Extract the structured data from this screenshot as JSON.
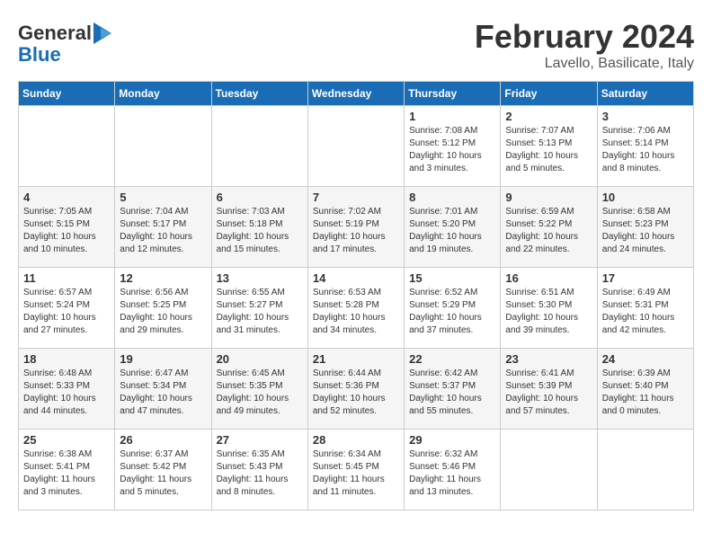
{
  "logo": {
    "line1": "General",
    "line2": "Blue"
  },
  "title": "February 2024",
  "subtitle": "Lavello, Basilicate, Italy",
  "days_of_week": [
    "Sunday",
    "Monday",
    "Tuesday",
    "Wednesday",
    "Thursday",
    "Friday",
    "Saturday"
  ],
  "weeks": [
    [
      {
        "day": "",
        "content": ""
      },
      {
        "day": "",
        "content": ""
      },
      {
        "day": "",
        "content": ""
      },
      {
        "day": "",
        "content": ""
      },
      {
        "day": "1",
        "content": "Sunrise: 7:08 AM\nSunset: 5:12 PM\nDaylight: 10 hours\nand 3 minutes."
      },
      {
        "day": "2",
        "content": "Sunrise: 7:07 AM\nSunset: 5:13 PM\nDaylight: 10 hours\nand 5 minutes."
      },
      {
        "day": "3",
        "content": "Sunrise: 7:06 AM\nSunset: 5:14 PM\nDaylight: 10 hours\nand 8 minutes."
      }
    ],
    [
      {
        "day": "4",
        "content": "Sunrise: 7:05 AM\nSunset: 5:15 PM\nDaylight: 10 hours\nand 10 minutes."
      },
      {
        "day": "5",
        "content": "Sunrise: 7:04 AM\nSunset: 5:17 PM\nDaylight: 10 hours\nand 12 minutes."
      },
      {
        "day": "6",
        "content": "Sunrise: 7:03 AM\nSunset: 5:18 PM\nDaylight: 10 hours\nand 15 minutes."
      },
      {
        "day": "7",
        "content": "Sunrise: 7:02 AM\nSunset: 5:19 PM\nDaylight: 10 hours\nand 17 minutes."
      },
      {
        "day": "8",
        "content": "Sunrise: 7:01 AM\nSunset: 5:20 PM\nDaylight: 10 hours\nand 19 minutes."
      },
      {
        "day": "9",
        "content": "Sunrise: 6:59 AM\nSunset: 5:22 PM\nDaylight: 10 hours\nand 22 minutes."
      },
      {
        "day": "10",
        "content": "Sunrise: 6:58 AM\nSunset: 5:23 PM\nDaylight: 10 hours\nand 24 minutes."
      }
    ],
    [
      {
        "day": "11",
        "content": "Sunrise: 6:57 AM\nSunset: 5:24 PM\nDaylight: 10 hours\nand 27 minutes."
      },
      {
        "day": "12",
        "content": "Sunrise: 6:56 AM\nSunset: 5:25 PM\nDaylight: 10 hours\nand 29 minutes."
      },
      {
        "day": "13",
        "content": "Sunrise: 6:55 AM\nSunset: 5:27 PM\nDaylight: 10 hours\nand 31 minutes."
      },
      {
        "day": "14",
        "content": "Sunrise: 6:53 AM\nSunset: 5:28 PM\nDaylight: 10 hours\nand 34 minutes."
      },
      {
        "day": "15",
        "content": "Sunrise: 6:52 AM\nSunset: 5:29 PM\nDaylight: 10 hours\nand 37 minutes."
      },
      {
        "day": "16",
        "content": "Sunrise: 6:51 AM\nSunset: 5:30 PM\nDaylight: 10 hours\nand 39 minutes."
      },
      {
        "day": "17",
        "content": "Sunrise: 6:49 AM\nSunset: 5:31 PM\nDaylight: 10 hours\nand 42 minutes."
      }
    ],
    [
      {
        "day": "18",
        "content": "Sunrise: 6:48 AM\nSunset: 5:33 PM\nDaylight: 10 hours\nand 44 minutes."
      },
      {
        "day": "19",
        "content": "Sunrise: 6:47 AM\nSunset: 5:34 PM\nDaylight: 10 hours\nand 47 minutes."
      },
      {
        "day": "20",
        "content": "Sunrise: 6:45 AM\nSunset: 5:35 PM\nDaylight: 10 hours\nand 49 minutes."
      },
      {
        "day": "21",
        "content": "Sunrise: 6:44 AM\nSunset: 5:36 PM\nDaylight: 10 hours\nand 52 minutes."
      },
      {
        "day": "22",
        "content": "Sunrise: 6:42 AM\nSunset: 5:37 PM\nDaylight: 10 hours\nand 55 minutes."
      },
      {
        "day": "23",
        "content": "Sunrise: 6:41 AM\nSunset: 5:39 PM\nDaylight: 10 hours\nand 57 minutes."
      },
      {
        "day": "24",
        "content": "Sunrise: 6:39 AM\nSunset: 5:40 PM\nDaylight: 11 hours\nand 0 minutes."
      }
    ],
    [
      {
        "day": "25",
        "content": "Sunrise: 6:38 AM\nSunset: 5:41 PM\nDaylight: 11 hours\nand 3 minutes."
      },
      {
        "day": "26",
        "content": "Sunrise: 6:37 AM\nSunset: 5:42 PM\nDaylight: 11 hours\nand 5 minutes."
      },
      {
        "day": "27",
        "content": "Sunrise: 6:35 AM\nSunset: 5:43 PM\nDaylight: 11 hours\nand 8 minutes."
      },
      {
        "day": "28",
        "content": "Sunrise: 6:34 AM\nSunset: 5:45 PM\nDaylight: 11 hours\nand 11 minutes."
      },
      {
        "day": "29",
        "content": "Sunrise: 6:32 AM\nSunset: 5:46 PM\nDaylight: 11 hours\nand 13 minutes."
      },
      {
        "day": "",
        "content": ""
      },
      {
        "day": "",
        "content": ""
      }
    ]
  ]
}
